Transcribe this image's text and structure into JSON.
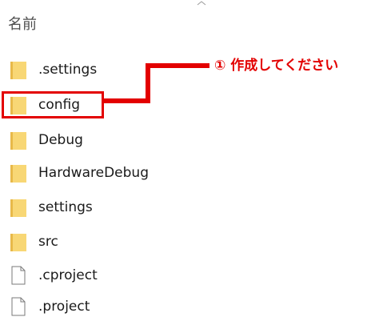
{
  "header": {
    "name_column": "名前"
  },
  "icons": {
    "folder": "folder-icon",
    "file": "file-icon",
    "sort": "chevron-up-icon"
  },
  "colors": {
    "folder": "#F8D775",
    "folder_tab": "#E8B94A",
    "annotation": "#E30000"
  },
  "files": [
    {
      "name": ".settings",
      "type": "folder"
    },
    {
      "name": "config",
      "type": "folder"
    },
    {
      "name": "Debug",
      "type": "folder"
    },
    {
      "name": "HardwareDebug",
      "type": "folder"
    },
    {
      "name": "settings",
      "type": "folder"
    },
    {
      "name": "src",
      "type": "folder"
    },
    {
      "name": ".cproject",
      "type": "file"
    },
    {
      "name": ".project",
      "type": "file"
    }
  ],
  "annotation": {
    "text": "① 作成してください"
  }
}
